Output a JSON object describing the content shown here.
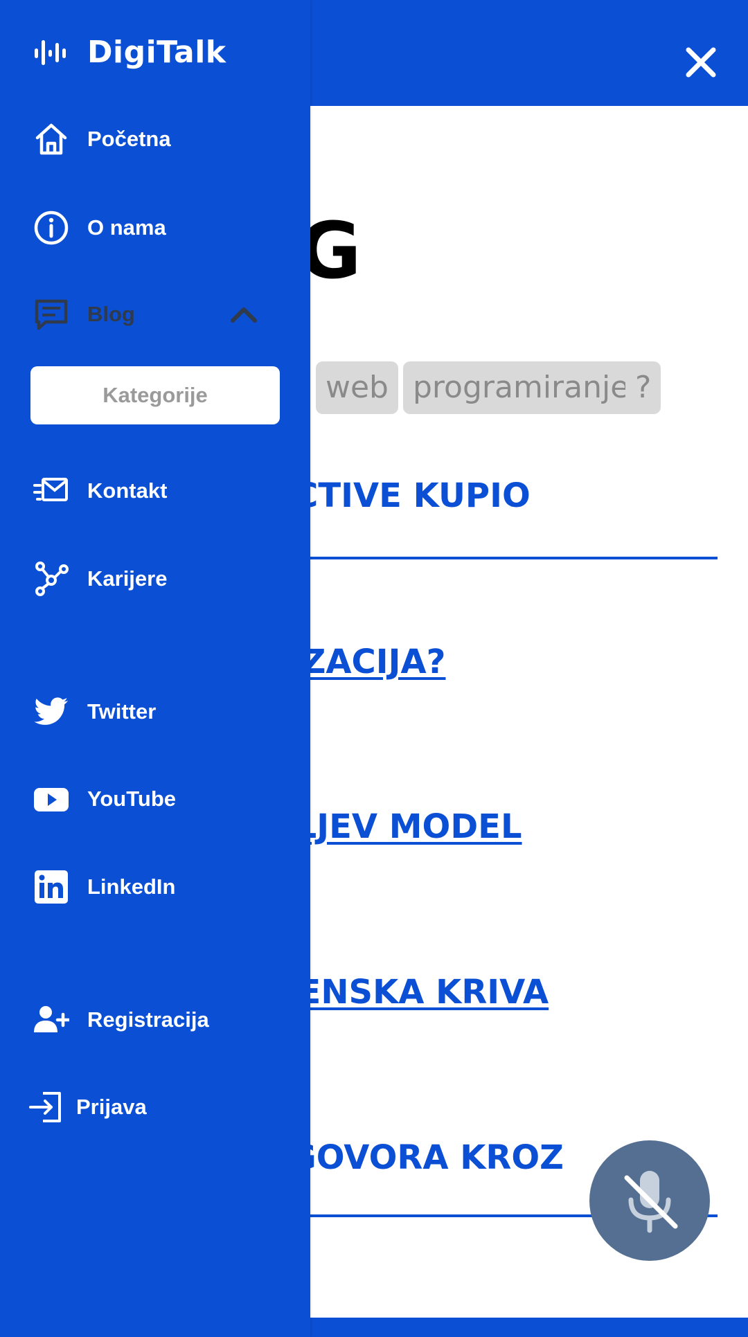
{
  "app": {
    "name": "DigiTalk"
  },
  "drawer": {
    "nav": [
      {
        "label": "Početna",
        "icon": "home-icon"
      },
      {
        "label": "O nama",
        "icon": "info-icon"
      },
      {
        "label": "Blog",
        "icon": "message-square-icon",
        "expanded": true
      },
      {
        "label": "Kontakt",
        "icon": "mail-icon"
      },
      {
        "label": "Karijere",
        "icon": "network-icon"
      }
    ],
    "blog_sub": {
      "kategorije": "Kategorije"
    },
    "social": [
      {
        "label": "Twitter",
        "icon": "twitter-icon"
      },
      {
        "label": "YouTube",
        "icon": "youtube-icon"
      },
      {
        "label": "LinkedIn",
        "icon": "linkedin-icon"
      }
    ],
    "account": [
      {
        "label": "Registracija",
        "icon": "user-plus-icon"
      },
      {
        "label": "Prijava",
        "icon": "sign-in-icon"
      }
    ]
  },
  "main": {
    "heading": "G",
    "tags": [
      "web",
      "programiranje",
      "?"
    ],
    "posts": [
      "RACTIVE KUPIO",
      "ALIZACIJA?",
      "OVLJEV MODEL",
      "EMENSKA KRIVA",
      "JE GOVORA KROZ"
    ]
  },
  "colors": {
    "primary": "#0b4fd4",
    "mic": "#546f91",
    "muted": "#2f3a4d"
  }
}
